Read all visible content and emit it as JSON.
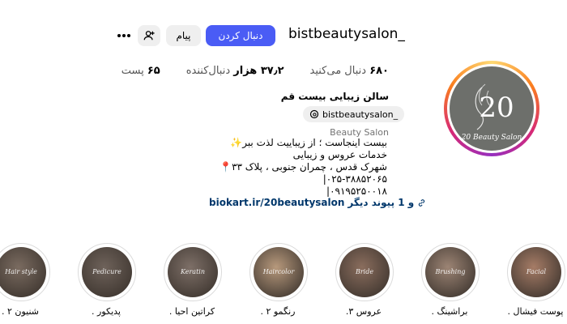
{
  "header": {
    "username": "bistbeautysalon_",
    "follow_label": "دنبال کردن",
    "message_label": "پیام",
    "suggest_icon": "add-person-icon",
    "more_icon": "more-icon"
  },
  "stats": {
    "posts_count": "۶۵",
    "posts_label": "پست",
    "followers_count": "۳۷٫۲ هزار",
    "followers_label": "دنبال‌کننده",
    "following_count": "۶۸۰",
    "following_label": "دنبال می‌کنید"
  },
  "bio": {
    "name": "سالن زیبایی بیست قم",
    "threads_handle": "bistbeautysalon_",
    "category": "Beauty Salon",
    "lines": [
      "بیست اینجاست ؛ از زیباییت لذت ببر✨",
      "خدمات عروس و زیبایی",
      "شهرک قدس ، چمران جنوبی ، پلاک ۳۳📍",
      "۰۲۵-۳۸۸۵۲۰۶۵|",
      "۰۹۱۹۵۲۵۰۰۱۸|"
    ],
    "link_url": "biokart.ir/20beautysalon",
    "link_more": "و 1 پیوند دیگر"
  },
  "avatar": {
    "logo_text": "20",
    "logo_caption": "20 Beauty Salon"
  },
  "highlights": [
    {
      "label": "پوست فیشال .",
      "cover_text": "Facial",
      "color": "#a67c66"
    },
    {
      "label": "براشینگ .",
      "cover_text": "Brushing",
      "color": "#9c8474"
    },
    {
      "label": "عروس ۳.",
      "cover_text": "Bride",
      "color": "#8a6d5d"
    },
    {
      "label": "رنگمو ۲ .",
      "cover_text": "Haircolor",
      "color": "#b7997c"
    },
    {
      "label": "کراتین احیا .",
      "cover_text": "Keratin",
      "color": "#7d6f67"
    },
    {
      "label": "پدیکور .",
      "cover_text": "Pedicure",
      "color": "#6e625a"
    },
    {
      "label": "شنیون ۲ .",
      "cover_text": "Hair style",
      "color": "#7a6b60"
    }
  ]
}
